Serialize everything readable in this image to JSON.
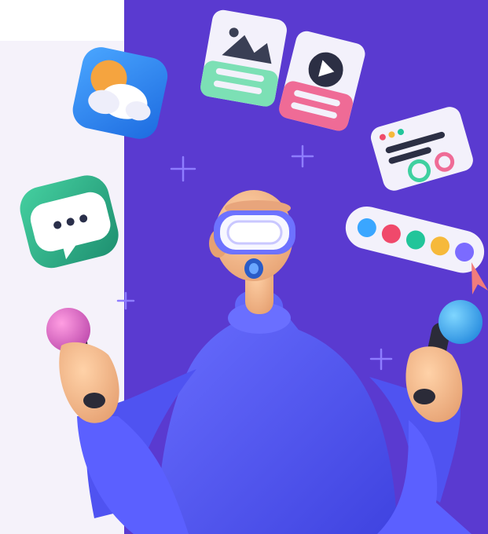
{
  "colors": {
    "purple_panel": "#5a3ad0",
    "light_panel": "#f5f2fa",
    "white": "#ffffff",
    "skin": "#f2b98a",
    "skin_shadow": "#d98a5e",
    "sweater": "#4f53f1",
    "sweater_light": "#6b70ff",
    "headset": "#f7f7ff",
    "visor": "#c9c7ff",
    "controller_pink": "#e27ad0",
    "controller_blue": "#47b8f7",
    "controller_dark": "#2b2b38",
    "chat_green": "#30b58d",
    "weather_blue": "#2f86f0",
    "sun_orange": "#f5a43f",
    "card_white": "#f3f1fb",
    "card_mint": "#7ce0b5",
    "card_pink": "#ef6b96",
    "plus_color": "#8e7dff"
  },
  "icons": [
    "weather-app-icon",
    "chat-bubble-icon",
    "image-card-icon",
    "video-play-card-icon",
    "code-editor-card-icon",
    "color-palette-bar-icon",
    "cursor-arrow-icon",
    "plus-sparkle-icon"
  ],
  "palette_dots": [
    "#3aa6ff",
    "#f0496b",
    "#22c59a",
    "#f6b93b",
    "#7b6bff"
  ]
}
